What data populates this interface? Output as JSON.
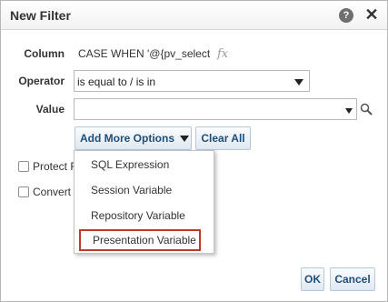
{
  "dialog": {
    "title": "New Filter"
  },
  "form": {
    "column_label": "Column",
    "column_value": "CASE WHEN '@{pv_select",
    "operator_label": "Operator",
    "operator_value": "is equal to / is in",
    "value_label": "Value",
    "value_input": ""
  },
  "buttons": {
    "add_more": "Add More Options",
    "clear_all": "Clear All",
    "ok": "OK",
    "cancel": "Cancel"
  },
  "checkboxes": {
    "protect": "Protect F",
    "convert": "Convert"
  },
  "menu": {
    "items": [
      "SQL Expression",
      "Session Variable",
      "Repository Variable",
      "Presentation Variable"
    ],
    "highlighted_index": 3
  },
  "icons": {
    "help": "help-icon",
    "close": "close-icon",
    "fx": "fx-icon",
    "search": "search-icon"
  },
  "colors": {
    "button_text": "#1f4e79",
    "highlight_border": "#c0392b"
  }
}
